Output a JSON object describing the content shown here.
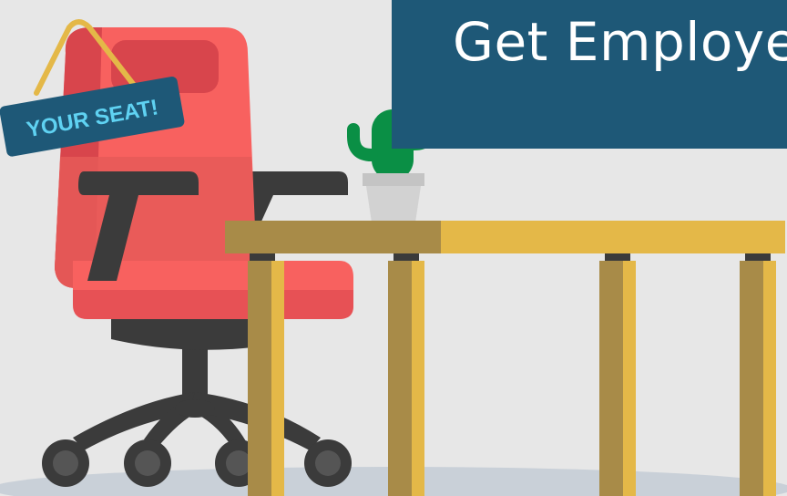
{
  "banner": {
    "title": "Get Employe"
  },
  "sign": {
    "text": "YOUR SEAT!"
  },
  "colors": {
    "background": "#e7e7e7",
    "banner": "#1e5877",
    "chair_red": "#f8615f",
    "chair_dark_red": "#d8454c",
    "chair_frame": "#3b3b3b",
    "desk_light": "#e4b848",
    "desk_dark": "#a88b48",
    "cactus": "#0a8f45",
    "pot": "#d2d2d2",
    "sign_bg": "#1e5877",
    "sign_text": "#5fd2f2",
    "shadow": "#c9d0d8"
  },
  "icons": [
    "office-chair-icon",
    "desk-icon",
    "cactus-plant-icon",
    "hanging-sign-icon"
  ]
}
